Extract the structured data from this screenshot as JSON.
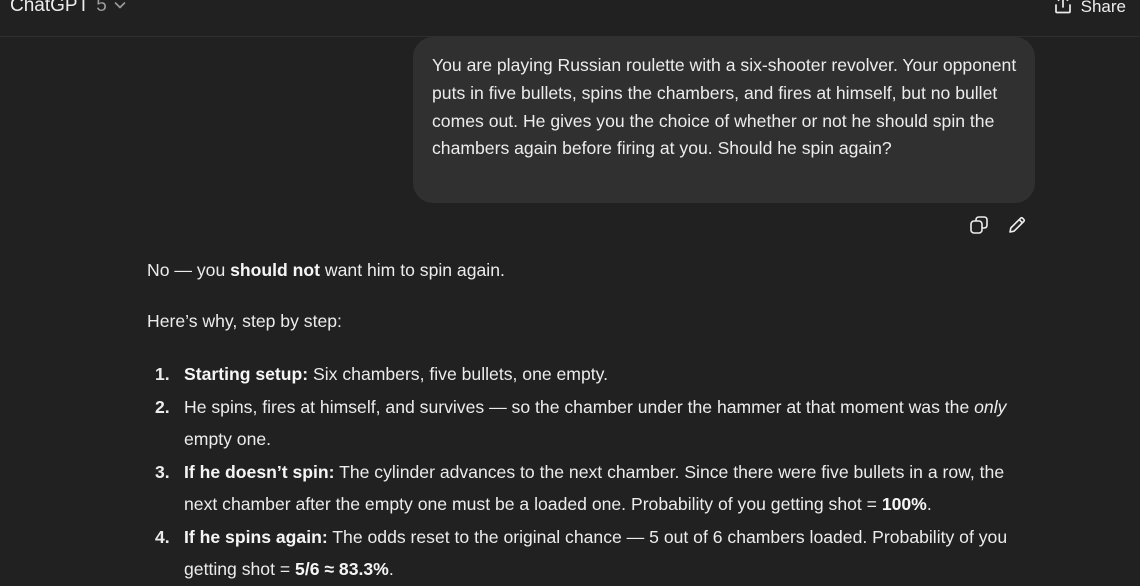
{
  "header": {
    "app_name": "ChatGPT",
    "model_version": "5",
    "share_label": "Share"
  },
  "user_message": {
    "text": "You are playing Russian roulette with a six-shooter revolver. Your opponent puts in five bullets, spins the chambers, and fires at himself, but no bullet comes out. He gives you the choice of whether or not he should spin the chambers again before firing at you. Should he spin again?"
  },
  "message_actions": {
    "copy_icon": "copy-icon",
    "edit_icon": "pencil-icon"
  },
  "assistant": {
    "answer": {
      "prefix": "No — you ",
      "bold": "should not",
      "suffix": " want him to spin again."
    },
    "intro": "Here’s why, step by step:",
    "steps": [
      {
        "number": "1.",
        "bold": "Starting setup:",
        "text": " Six chambers, five bullets, one empty."
      },
      {
        "number": "2.",
        "text_a": "He spins, fires at himself, and survives — so the chamber under the hammer at that moment was the ",
        "italic": "only",
        "text_b": " empty one."
      },
      {
        "number": "3.",
        "bold": "If he doesn’t spin:",
        "text": " The cylinder advances to the next chamber. Since there were five bullets in a row, the next chamber after the empty one must be a loaded one. Probability of you getting shot = ",
        "bold_value": "100%",
        "end": "."
      },
      {
        "number": "4.",
        "bold": "If he spins again:",
        "text": " The odds reset to the original chance — 5 out of 6 chambers loaded. Probability of you getting shot = ",
        "bold_value": "5/6 ≈ 83.3%",
        "end": "."
      }
    ]
  },
  "colors": {
    "background": "#212121",
    "bubble": "#303030",
    "text": "#ececec",
    "muted": "#9b9b9b"
  }
}
